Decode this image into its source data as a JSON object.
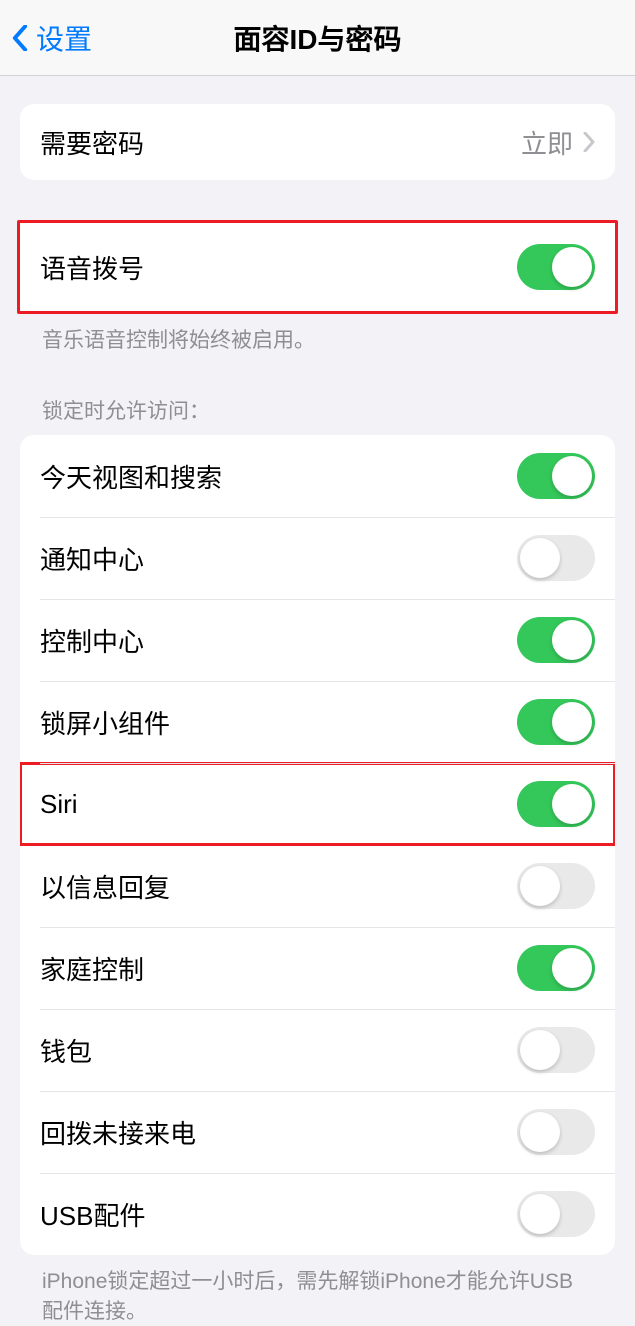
{
  "nav": {
    "back_label": "设置",
    "title": "面容ID与密码"
  },
  "section_passcode": {
    "require_label": "需要密码",
    "require_value": "立即"
  },
  "section_voice": {
    "voice_dial_label": "语音拨号",
    "footer": "音乐语音控制将始终被启用。"
  },
  "section_locked": {
    "header": "锁定时允许访问：",
    "items": [
      {
        "label": "今天视图和搜索",
        "on": true
      },
      {
        "label": "通知中心",
        "on": false
      },
      {
        "label": "控制中心",
        "on": true
      },
      {
        "label": "锁屏小组件",
        "on": true
      },
      {
        "label": "Siri",
        "on": true
      },
      {
        "label": "以信息回复",
        "on": false
      },
      {
        "label": "家庭控制",
        "on": true
      },
      {
        "label": "钱包",
        "on": false
      },
      {
        "label": "回拨未接来电",
        "on": false
      },
      {
        "label": "USB配件",
        "on": false
      }
    ],
    "footer": "iPhone锁定超过一小时后，需先解锁iPhone才能允许USB配件连接。"
  }
}
